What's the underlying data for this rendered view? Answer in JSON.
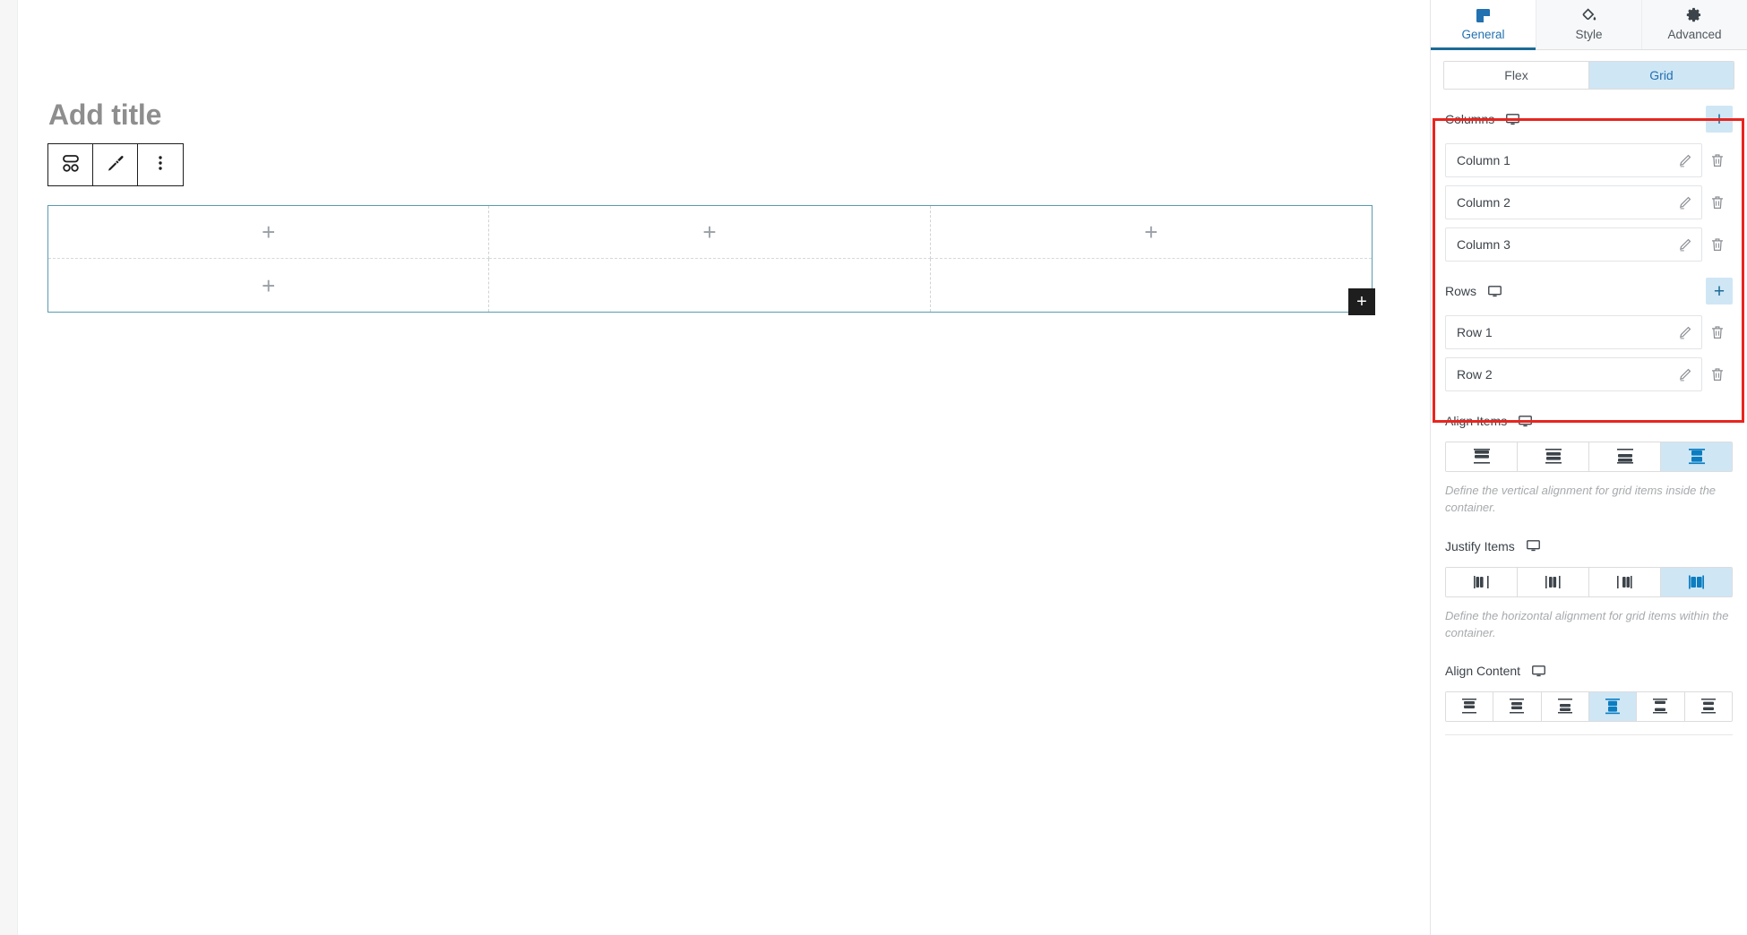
{
  "canvas": {
    "title": "Add title",
    "toolbar": [
      {
        "name": "block-layout-icon",
        "label": "Layout"
      },
      {
        "name": "paintbrush-icon",
        "label": "Edit"
      },
      {
        "name": "more-options-icon",
        "label": "Options"
      }
    ],
    "grid": {
      "columns": 3,
      "rows": 2,
      "cells": [
        {
          "id": "r1c1",
          "add_glyph": "+",
          "visible": true
        },
        {
          "id": "r1c2",
          "add_glyph": "+",
          "visible": true
        },
        {
          "id": "r1c3",
          "add_glyph": "+",
          "visible": true
        },
        {
          "id": "r2c1",
          "add_glyph": "+",
          "visible": true
        },
        {
          "id": "r2c2",
          "add_glyph": "+",
          "visible": false
        },
        {
          "id": "r2c3",
          "add_glyph": "+",
          "visible": false
        }
      ],
      "add_button_glyph": "+",
      "border_color": "#5a9bb0"
    }
  },
  "panel": {
    "tabs": [
      {
        "label": "General",
        "icon": "general-square-icon",
        "active": true
      },
      {
        "label": "Style",
        "icon": "paint-bucket-icon",
        "active": false
      },
      {
        "label": "Advanced",
        "icon": "gear-icon",
        "active": false
      }
    ],
    "layout_toggle": {
      "options": [
        {
          "label": "Flex",
          "active": false
        },
        {
          "label": "Grid",
          "active": true
        }
      ]
    },
    "columns_section": {
      "title": "Columns",
      "device_icon": "desktop-icon",
      "add_glyph": "+",
      "items": [
        {
          "label": "Column 1"
        },
        {
          "label": "Column 2"
        },
        {
          "label": "Column 3"
        }
      ]
    },
    "rows_section": {
      "title": "Rows",
      "device_icon": "desktop-icon",
      "add_glyph": "+",
      "items": [
        {
          "label": "Row 1"
        },
        {
          "label": "Row 2"
        }
      ]
    },
    "align_items": {
      "title": "Align Items",
      "device_icon": "desktop-icon",
      "options": [
        {
          "name": "align-items-start",
          "active": false
        },
        {
          "name": "align-items-center",
          "active": false
        },
        {
          "name": "align-items-end",
          "active": false
        },
        {
          "name": "align-items-stretch",
          "active": true
        }
      ],
      "help": "Define the vertical alignment for grid items inside the container."
    },
    "justify_items": {
      "title": "Justify Items",
      "device_icon": "desktop-icon",
      "options": [
        {
          "name": "justify-items-start",
          "active": false
        },
        {
          "name": "justify-items-center",
          "active": false
        },
        {
          "name": "justify-items-end",
          "active": false
        },
        {
          "name": "justify-items-stretch",
          "active": true
        }
      ],
      "help": "Define the horizontal alignment for grid items within the container."
    },
    "align_content": {
      "title": "Align Content",
      "device_icon": "desktop-icon",
      "options": [
        {
          "name": "align-content-start",
          "active": false
        },
        {
          "name": "align-content-center",
          "active": false
        },
        {
          "name": "align-content-end",
          "active": false
        },
        {
          "name": "align-content-stretch",
          "active": true
        },
        {
          "name": "align-content-space-between",
          "active": false
        },
        {
          "name": "align-content-space-around",
          "active": false
        }
      ]
    },
    "highlight_color": "#e8251f",
    "accent_color": "#2271b1",
    "active_bg_color": "#cfe6f5"
  }
}
